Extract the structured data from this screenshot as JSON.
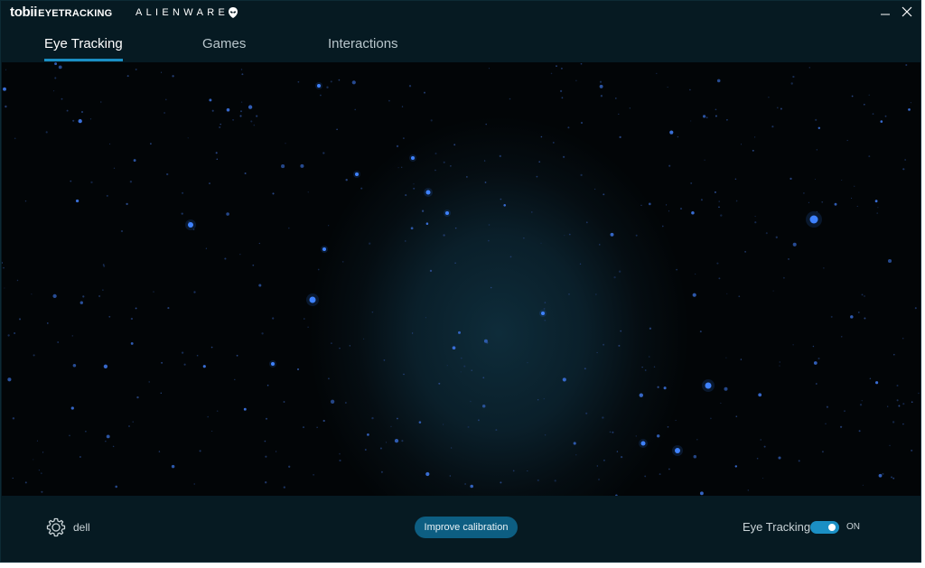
{
  "titlebar": {
    "brand_tobii": "tobii",
    "brand_tobii_sub": "EYETRACKING",
    "brand_partner": "ALIENWARE",
    "minimize_icon": "minimize-icon",
    "close_icon": "close-icon"
  },
  "tabs": [
    {
      "label": "Eye Tracking",
      "active": true
    },
    {
      "label": "Games",
      "active": false
    },
    {
      "label": "Interactions",
      "active": false
    }
  ],
  "footer": {
    "settings_icon": "gear-icon",
    "user_name": "dell",
    "calibration_button": "Improve calibration",
    "eye_tracking_label": "Eye Tracking",
    "eye_tracking_state": "ON",
    "eye_tracking_enabled": true
  },
  "colors": {
    "accent": "#1b8fc4",
    "background": "#061a22",
    "button": "#0d5e82"
  }
}
